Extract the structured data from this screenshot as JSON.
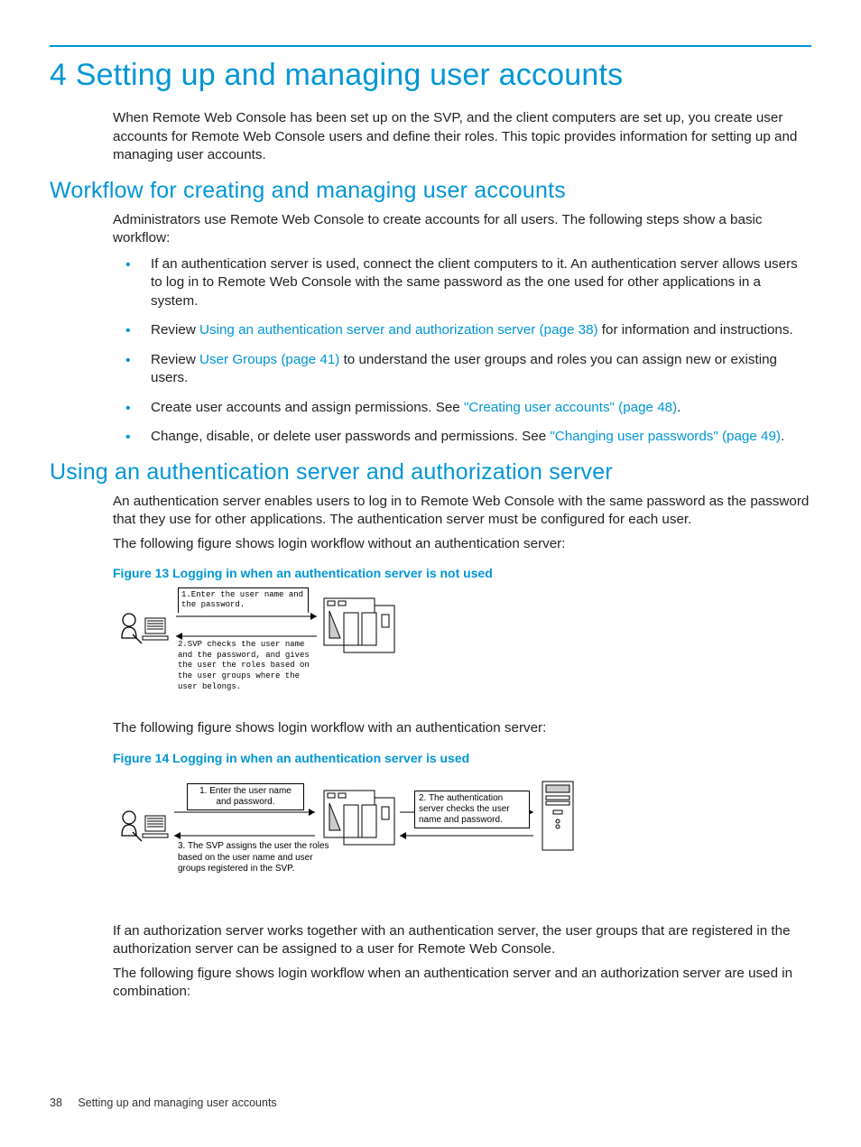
{
  "chapter_title": "4 Setting up and managing user accounts",
  "intro_para": "When Remote Web Console has been set up on the SVP, and the client computers are set up, you create user accounts for Remote Web Console users and define their roles. This topic provides information for setting up and managing user accounts.",
  "section1": {
    "title": "Workflow for creating and managing user accounts",
    "lead": "Administrators use Remote Web Console to create accounts for all users. The following steps show a basic workflow:",
    "bullets": {
      "b0a": "If an authentication server is used, connect the client computers to it. An authentication server allows users to log in to Remote Web Console with the same password as the one used for other applications in a system.",
      "b1a": "Review ",
      "b1link": "Using an authentication server and authorization server (page 38)",
      "b1b": " for information and instructions.",
      "b2a": "Review ",
      "b2link": "User Groups (page 41)",
      "b2b": " to understand the user groups and roles you can assign new or existing users.",
      "b3a": "Create user accounts and assign permissions. See ",
      "b3link": "\"Creating user accounts\" (page 48)",
      "b3b": ".",
      "b4a": "Change, disable, or delete user passwords and permissions. See ",
      "b4link": "\"Changing user passwords\" (page 49)",
      "b4b": "."
    }
  },
  "section2": {
    "title": "Using an authentication server and authorization server",
    "p1": "An authentication server enables users to log in to Remote Web Console with the same password as the password that they use for other applications. The authentication server must be configured for each user.",
    "p2": "The following figure shows login workflow without an authentication server:",
    "fig13_title": "Figure 13 Logging in when an authentication server is not used",
    "fig13": {
      "step1": "1.Enter the user name and the password.",
      "step2": "2.SVP checks the user name and the password, and gives the user the roles based on the user groups where the user belongs."
    },
    "p3": "The following figure shows login workflow with an authentication server:",
    "fig14_title": "Figure 14 Logging in when an authentication server is used",
    "fig14": {
      "step1": "1. Enter the user name and password.",
      "step2": "2. The authentication server checks the user name and password.",
      "step3": "3. The SVP assigns the user the roles based on the user name and user groups registered in the SVP."
    },
    "p4": "If an authorization server works together with an authentication server, the user groups that are registered in the authorization server can be assigned to a user for Remote Web Console.",
    "p5": "The following figure shows login workflow when an authentication server and an authorization server are used in combination:"
  },
  "footer": {
    "page_number": "38",
    "running_title": "Setting up and managing user accounts"
  }
}
